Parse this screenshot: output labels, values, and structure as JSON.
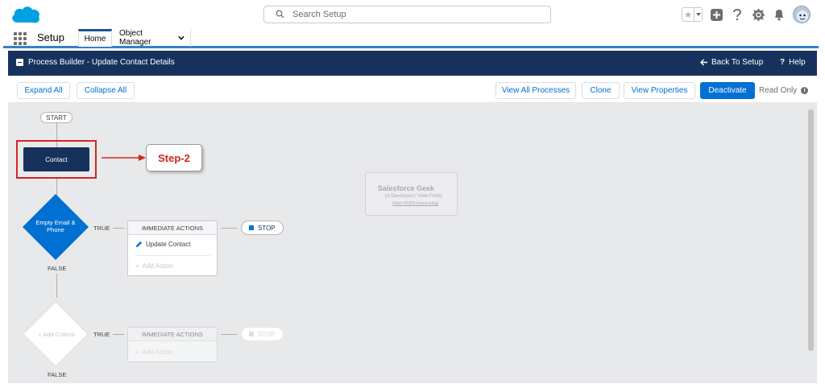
{
  "header": {
    "search_placeholder": "Search Setup",
    "icons": [
      "favorites-star-icon",
      "favorites-dropdown-icon",
      "global-actions-plus-icon",
      "help-icon",
      "setup-gear-icon",
      "notifications-bell-icon",
      "avatar-icon"
    ]
  },
  "app_nav": {
    "app_name": "Setup",
    "tabs": [
      {
        "label": "Home"
      },
      {
        "label": "Object Manager"
      }
    ]
  },
  "builder": {
    "title": "Process Builder - Update Contact Details",
    "back_label": "Back To Setup",
    "help_label": "Help"
  },
  "toolbar": {
    "expand_all": "Expand All",
    "collapse_all": "Collapse All",
    "view_all_processes": "View All Processes",
    "clone": "Clone",
    "view_properties": "View Properties",
    "deactivate": "Deactivate",
    "read_only": "Read Only"
  },
  "canvas": {
    "start_label": "START",
    "object_label": "Contact",
    "callout": "Step-2",
    "criteria": [
      {
        "name": "Empty Email & Phone",
        "true_label": "TRUE",
        "false_label": "FALSE",
        "actions_header": "IMMEDIATE ACTIONS",
        "action": "Update Contact",
        "add_action": "Add Action",
        "stop_label": "STOP"
      },
      {
        "name": "Add Criteria",
        "true_label": "TRUE",
        "false_label": "FALSE",
        "actions_header": "IMMEDIATE ACTIONS",
        "add_action": "Add Action",
        "stop_label": "STOP"
      }
    ],
    "watermark": {
      "title": "Salesforce Geek",
      "subtitle": "(A Developers' View Point)",
      "url": "https://6302.home.blog/"
    }
  },
  "colors": {
    "brand_blue": "#0070d2",
    "header_navy": "#16325c",
    "highlight_red": "#d0271d",
    "callout_red": "#c92a1d",
    "canvas_gray": "#e8e9eb"
  }
}
